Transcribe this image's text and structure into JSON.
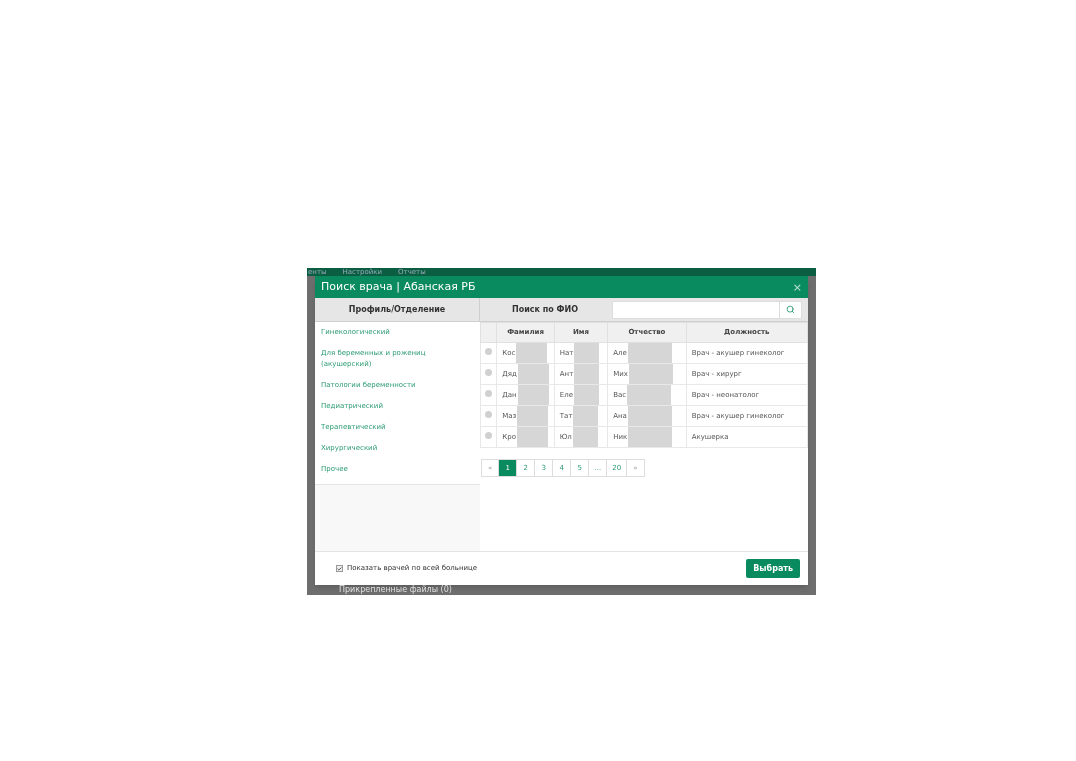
{
  "background_app": {
    "nav_items": [
      "енты",
      "Настройки",
      "Отчеты"
    ],
    "footer_text": "Прикрепленные файлы (0)"
  },
  "dialog": {
    "title": "Поиск врача | Абанская РБ",
    "close": "×",
    "sidebar": {
      "heading": "Профиль/Отделение",
      "items": [
        {
          "label": "Гинекологический",
          "selected": false
        },
        {
          "label": "Для беременных и рожениц (акушерский)",
          "selected": false
        },
        {
          "label": "Патологии беременности",
          "selected": false
        },
        {
          "label": "Педиатрический",
          "selected": false
        },
        {
          "label": "Терапевтический",
          "selected": false
        },
        {
          "label": "Хирургический",
          "selected": false
        },
        {
          "label": "Прочее",
          "selected": false
        }
      ]
    },
    "search": {
      "label": "Поиск по ФИО"
    },
    "table": {
      "columns": [
        "Фамилия",
        "Имя",
        "Отчество",
        "Должность"
      ],
      "rows": [
        {
          "selected": false,
          "cells": [
            "Кос",
            "Нат",
            "Але",
            "Врач - акушер гинеколог"
          ]
        },
        {
          "selected": false,
          "cells": [
            "Дяд",
            "Ант",
            "Мих",
            "Врач - хирург"
          ]
        },
        {
          "selected": false,
          "cells": [
            "Дан",
            "Еле",
            "Вас",
            "Врач - неонатолог"
          ]
        },
        {
          "selected": false,
          "cells": [
            "Маз",
            "Тат",
            "Ана",
            "Врач - акушер гинеколог"
          ]
        },
        {
          "selected": false,
          "cells": [
            "Кро",
            "Юл",
            "Ник",
            "Акушерка"
          ]
        }
      ]
    },
    "pagination": {
      "prev": "«",
      "next": "»",
      "pages": [
        {
          "label": "1",
          "selected": true
        },
        {
          "label": "2",
          "selected": false
        },
        {
          "label": "3",
          "selected": false
        },
        {
          "label": "4",
          "selected": false
        },
        {
          "label": "5",
          "selected": false
        },
        {
          "label": "...",
          "selected": false
        },
        {
          "label": "20",
          "selected": false
        }
      ]
    },
    "show_all": {
      "label": "Показать врачей по всей больнице",
      "checked": true
    },
    "submit": "Выбрать"
  }
}
